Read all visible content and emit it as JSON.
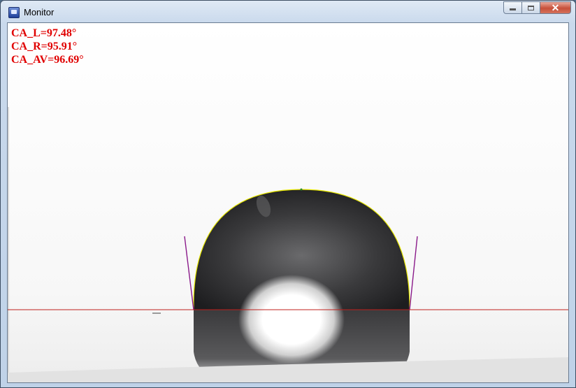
{
  "window": {
    "title": "Monitor",
    "icon": "app-monitor-icon"
  },
  "title_buttons": {
    "minimize_icon": "minimize-icon",
    "maximize_icon": "maximize-icon",
    "close_icon": "close-icon",
    "close_glyph": "✕"
  },
  "measurements": {
    "ca_left": "CA_L=97.48°",
    "ca_right": "CA_R=95.91°",
    "ca_average": "CA_AV=96.69°"
  },
  "colors": {
    "readout_text": "#e00000",
    "baseline": "#c0201c",
    "contour": "#e6e600",
    "tangent": "#8a1a8a",
    "droplet": "#2e2e30"
  }
}
